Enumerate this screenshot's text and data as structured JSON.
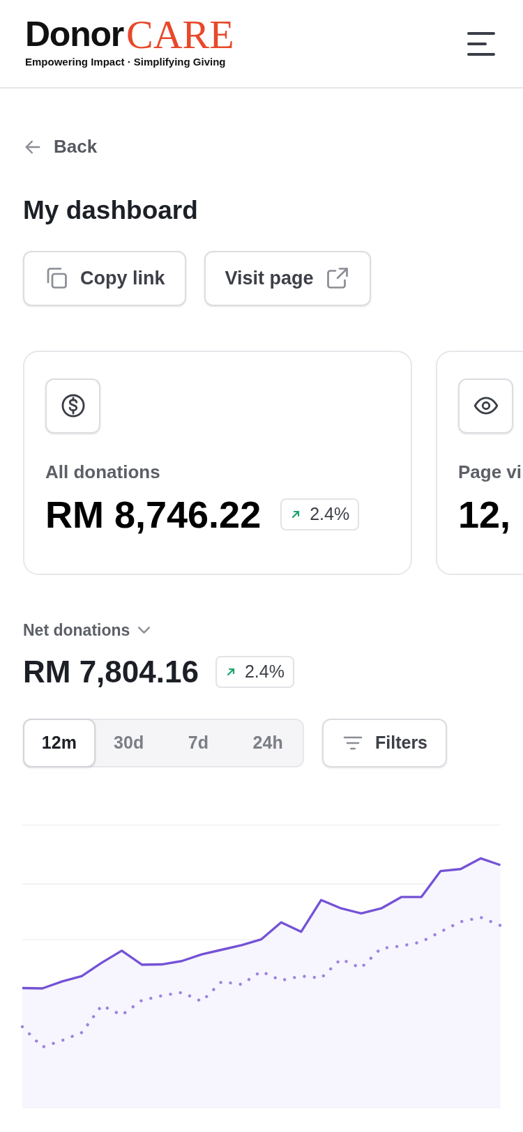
{
  "header": {
    "logo_main": "Donor",
    "logo_accent": "CARE",
    "tagline": "Empowering Impact · Simplifying Giving"
  },
  "back": {
    "label": "Back"
  },
  "title": "My dashboard",
  "actions": [
    {
      "label": "Copy link",
      "kind": "copy"
    },
    {
      "label": "Visit page",
      "kind": "external"
    }
  ],
  "stats": [
    {
      "kind": "dollar",
      "label": "All donations",
      "value": "RM 8,746.22",
      "change": {
        "rising": true,
        "text": "2.4%"
      }
    },
    {
      "kind": "eye",
      "label": "Page vi",
      "value": "12,"
    }
  ],
  "net": {
    "label": "Net donations",
    "value": "RM 7,804.16",
    "change": {
      "rising": true,
      "text": "2.4%"
    }
  },
  "ranges": [
    {
      "label": "12m",
      "selected": true
    },
    {
      "label": "30d",
      "selected": false
    },
    {
      "label": "7d",
      "selected": false
    },
    {
      "label": "24h",
      "selected": false
    }
  ],
  "filters": {
    "label": "Filters"
  }
}
